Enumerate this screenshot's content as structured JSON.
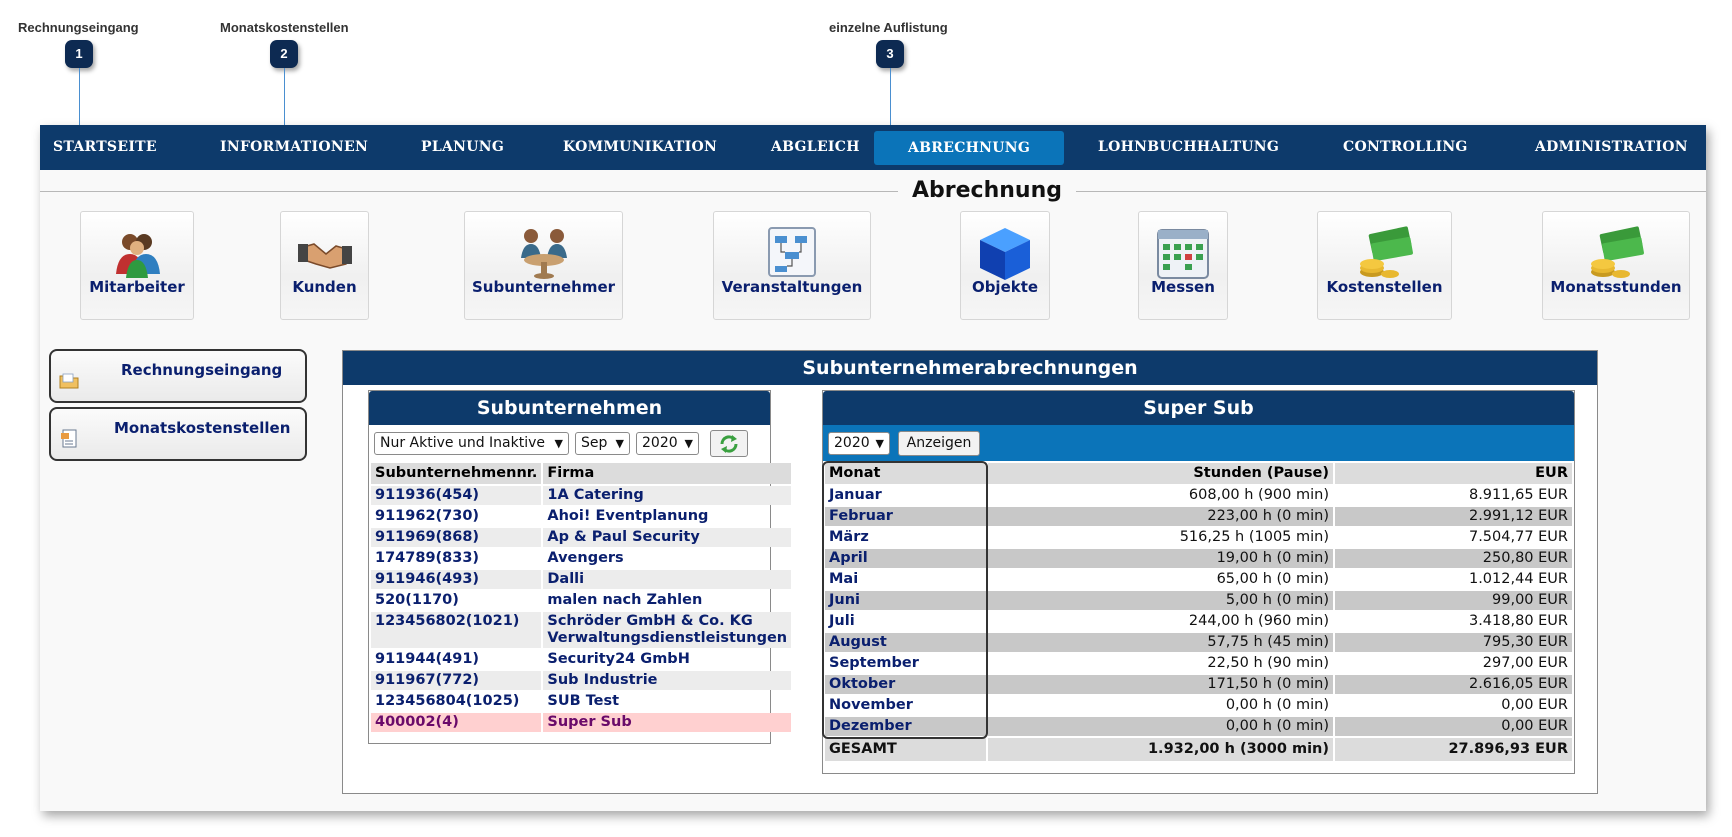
{
  "annotations": [
    {
      "label": "Rechnungseingang",
      "number": "1"
    },
    {
      "label": "Monatskostenstellen",
      "number": "2"
    },
    {
      "label": "einzelne Auflistung",
      "number": "3"
    }
  ],
  "nav": [
    "STARTSEITE",
    "INFORMATIONEN",
    "PLANUNG",
    "KOMMUNIKATION",
    "ABGLEICH",
    "ABRECHNUNG",
    "LOHNBUCHHALTUNG",
    "CONTROLLING",
    "ADMINISTRATION"
  ],
  "active_nav": "ABRECHNUNG",
  "section_title": "Abrechnung",
  "tiles": [
    {
      "label": "Mitarbeiter",
      "icon": "users-icon"
    },
    {
      "label": "Kunden",
      "icon": "handshake-icon"
    },
    {
      "label": "Subunternehmer",
      "icon": "meeting-icon"
    },
    {
      "label": "Veranstaltungen",
      "icon": "flowchart-icon"
    },
    {
      "label": "Objekte",
      "icon": "cube-icon"
    },
    {
      "label": "Messen",
      "icon": "calendar-icon"
    },
    {
      "label": "Kostenstellen",
      "icon": "money-icon"
    },
    {
      "label": "Monatsstunden",
      "icon": "money-icon"
    }
  ],
  "sidebar": [
    {
      "label": "Rechnungseingang",
      "icon": "folder-icon"
    },
    {
      "label": "Monatskostenstellen",
      "icon": "document-icon"
    }
  ],
  "panel_title": "Subunternehmerabrechnungen",
  "subunternehmen": {
    "title": "Subunternehmen",
    "filter_status": "Nur Aktive und Inaktive",
    "filter_month": "Sep",
    "filter_year": "2020",
    "refresh_icon": "refresh-icon",
    "columns": [
      "Subunternehmennr.",
      "Firma"
    ],
    "rows": [
      [
        "911936(454)",
        "1A Catering"
      ],
      [
        "911962(730)",
        "Ahoi! Eventplanung"
      ],
      [
        "911969(868)",
        "Ap & Paul Security"
      ],
      [
        "174789(833)",
        "Avengers"
      ],
      [
        "911946(493)",
        "Dalli"
      ],
      [
        "520(1170)",
        "malen nach Zahlen"
      ],
      [
        "123456802(1021)",
        "Schröder GmbH & Co. KG Verwaltungsdienstleistungen"
      ],
      [
        "911944(491)",
        "Security24 GmbH"
      ],
      [
        "911967(772)",
        "Sub Industrie"
      ],
      [
        "123456804(1025)",
        "SUB Test"
      ],
      [
        "400002(4)",
        "Super Sub"
      ]
    ],
    "selected": "Super Sub"
  },
  "detail": {
    "title": "Super Sub",
    "year": "2020",
    "show_button": "Anzeigen",
    "columns": [
      "Monat",
      "Stunden (Pause)",
      "EUR"
    ],
    "rows": [
      [
        "Januar",
        "608,00 h (900 min)",
        "8.911,65 EUR"
      ],
      [
        "Februar",
        "223,00 h (0 min)",
        "2.991,12 EUR"
      ],
      [
        "März",
        "516,25 h (1005 min)",
        "7.504,77 EUR"
      ],
      [
        "April",
        "19,00 h (0 min)",
        "250,80 EUR"
      ],
      [
        "Mai",
        "65,00 h (0 min)",
        "1.012,44 EUR"
      ],
      [
        "Juni",
        "5,00 h (0 min)",
        "99,00 EUR"
      ],
      [
        "Juli",
        "244,00 h (960 min)",
        "3.418,80 EUR"
      ],
      [
        "August",
        "57,75 h (45 min)",
        "795,30 EUR"
      ],
      [
        "September",
        "22,50 h (90 min)",
        "297,00 EUR"
      ],
      [
        "Oktober",
        "171,50 h (0 min)",
        "2.616,05 EUR"
      ],
      [
        "November",
        "0,00 h (0 min)",
        "0,00 EUR"
      ],
      [
        "Dezember",
        "0,00 h (0 min)",
        "0,00 EUR"
      ]
    ],
    "total": [
      "GESAMT",
      "1.932,00 h (3000 min)",
      "27.896,93 EUR"
    ]
  },
  "colors": {
    "nav_bg": "#0d3a6b",
    "accent": "#0b74b9",
    "link": "#0a1f6e",
    "selected_row": "#ffd0d0"
  }
}
